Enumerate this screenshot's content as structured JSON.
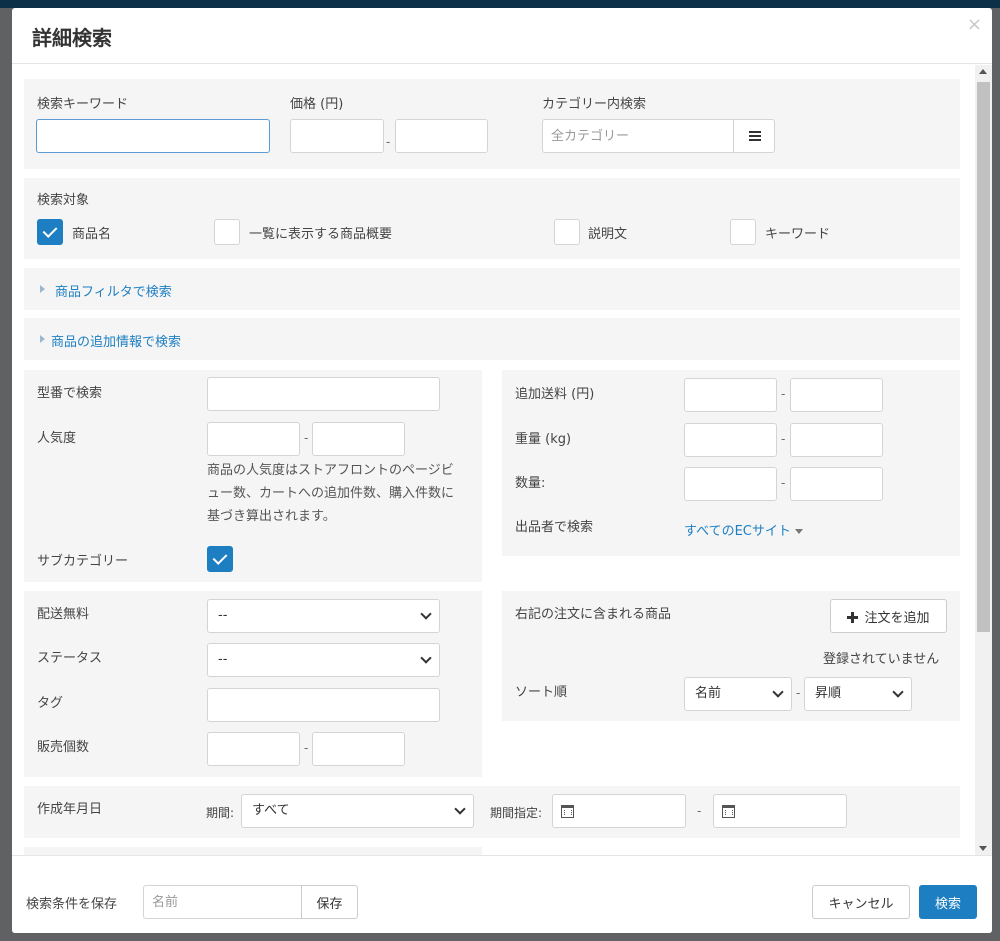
{
  "modal": {
    "title": "詳細検索",
    "close_label": "×"
  },
  "keyword": {
    "label": "検索キーワード",
    "value": ""
  },
  "price": {
    "label": "価格 (円)",
    "separator": "-"
  },
  "category": {
    "label": "カテゴリー内検索",
    "placeholder": "全カテゴリー",
    "menu_icon": "bars-icon"
  },
  "search_target": {
    "label": "検索対象",
    "options": [
      {
        "label": "商品名",
        "checked": true
      },
      {
        "label": "一覧に表示する商品概要",
        "checked": false
      },
      {
        "label": "説明文",
        "checked": false
      },
      {
        "label": "キーワード",
        "checked": false
      }
    ]
  },
  "collapsibles": {
    "filter": "商品フィルタで検索",
    "additional": "商品の追加情報で検索"
  },
  "left_panel": {
    "model_label": "型番で検索",
    "popularity_label": "人気度",
    "popularity_help": [
      "商品の人気度はストアフロントのページビ",
      "ュー数、カートへの追加件数、購入件数に",
      "基づき算出されます。"
    ],
    "subcategory_label": "サブカテゴリー",
    "subcategory_checked": true
  },
  "right_panel": {
    "shipping_label": "追加送料 (円)",
    "weight_label": "重量 (kg)",
    "quantity_label": "数量:",
    "seller_label": "出品者で検索",
    "seller_link": "すべてのECサイト"
  },
  "left_panel2": {
    "free_shipping_label": "配送無料",
    "free_shipping_value": "--",
    "status_label": "ステータス",
    "status_value": "--",
    "tag_label": "タグ",
    "sales_label": "販売個数"
  },
  "right_panel2": {
    "order_label": "右記の注文に含まれる商品",
    "add_order_button": "注文を追加",
    "not_registered": "登録されていません",
    "sort_label": "ソート順",
    "sort_field": "名前",
    "sort_direction": "昇順"
  },
  "created_date": {
    "label": "作成年月日",
    "period_label": "期間:",
    "period_value": "すべて",
    "range_label": "期間指定:"
  },
  "footer": {
    "save_label": "検索条件を保存",
    "name_placeholder": "名前",
    "save_button": "保存",
    "cancel_button": "キャンセル",
    "search_button": "検索"
  },
  "colors": {
    "accent": "#1d7fc2",
    "panel_bg": "#f5f5f5"
  }
}
